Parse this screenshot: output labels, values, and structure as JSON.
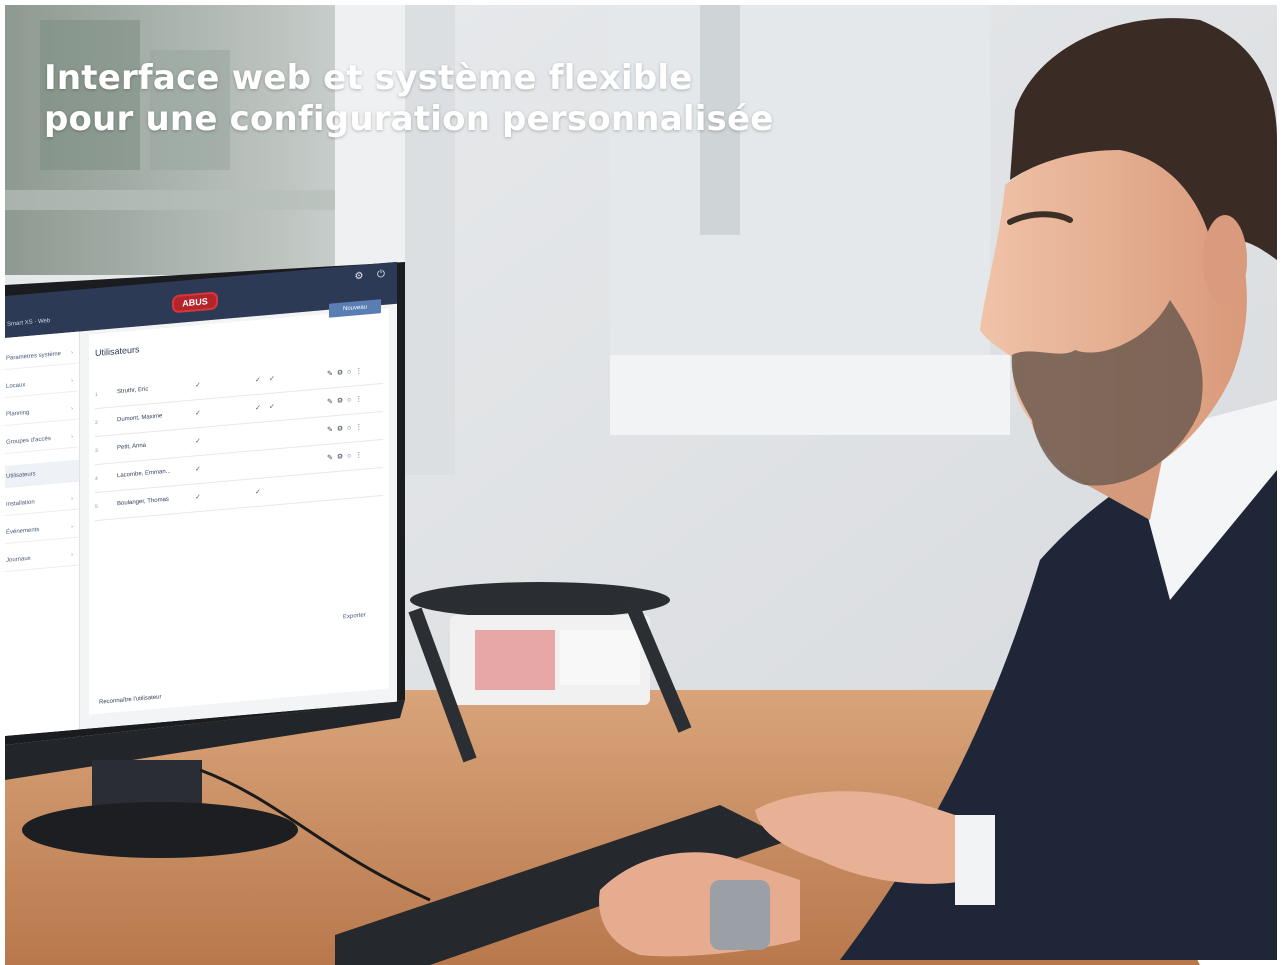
{
  "headline": {
    "line1": "Interface web et système flexible",
    "line2": "pour une configuration personnalisée"
  },
  "monitor": {
    "brand": "ABUS",
    "new_button": "Nouveau",
    "page_title": "Utilisateurs",
    "sidebar": [
      "Paramètres système",
      "Locaux",
      "Planning",
      "Groupes d'accès",
      "Utilisateurs",
      "Installation",
      "Événements",
      "Journaux"
    ],
    "users": [
      "Struthr, Eric",
      "Dumont, Maxime",
      "Petit, Anna",
      "Lacombe, Emman...",
      "Boulanger, Thomas"
    ],
    "export": "Exporter",
    "footer_link": "Reconnaître l'utilisateur"
  },
  "colors": {
    "headline": "#ffffff",
    "monitor_header": "#2d3a55",
    "logo": "#b3252b",
    "desk": "#c98b5e",
    "suit": "#1f2638"
  }
}
